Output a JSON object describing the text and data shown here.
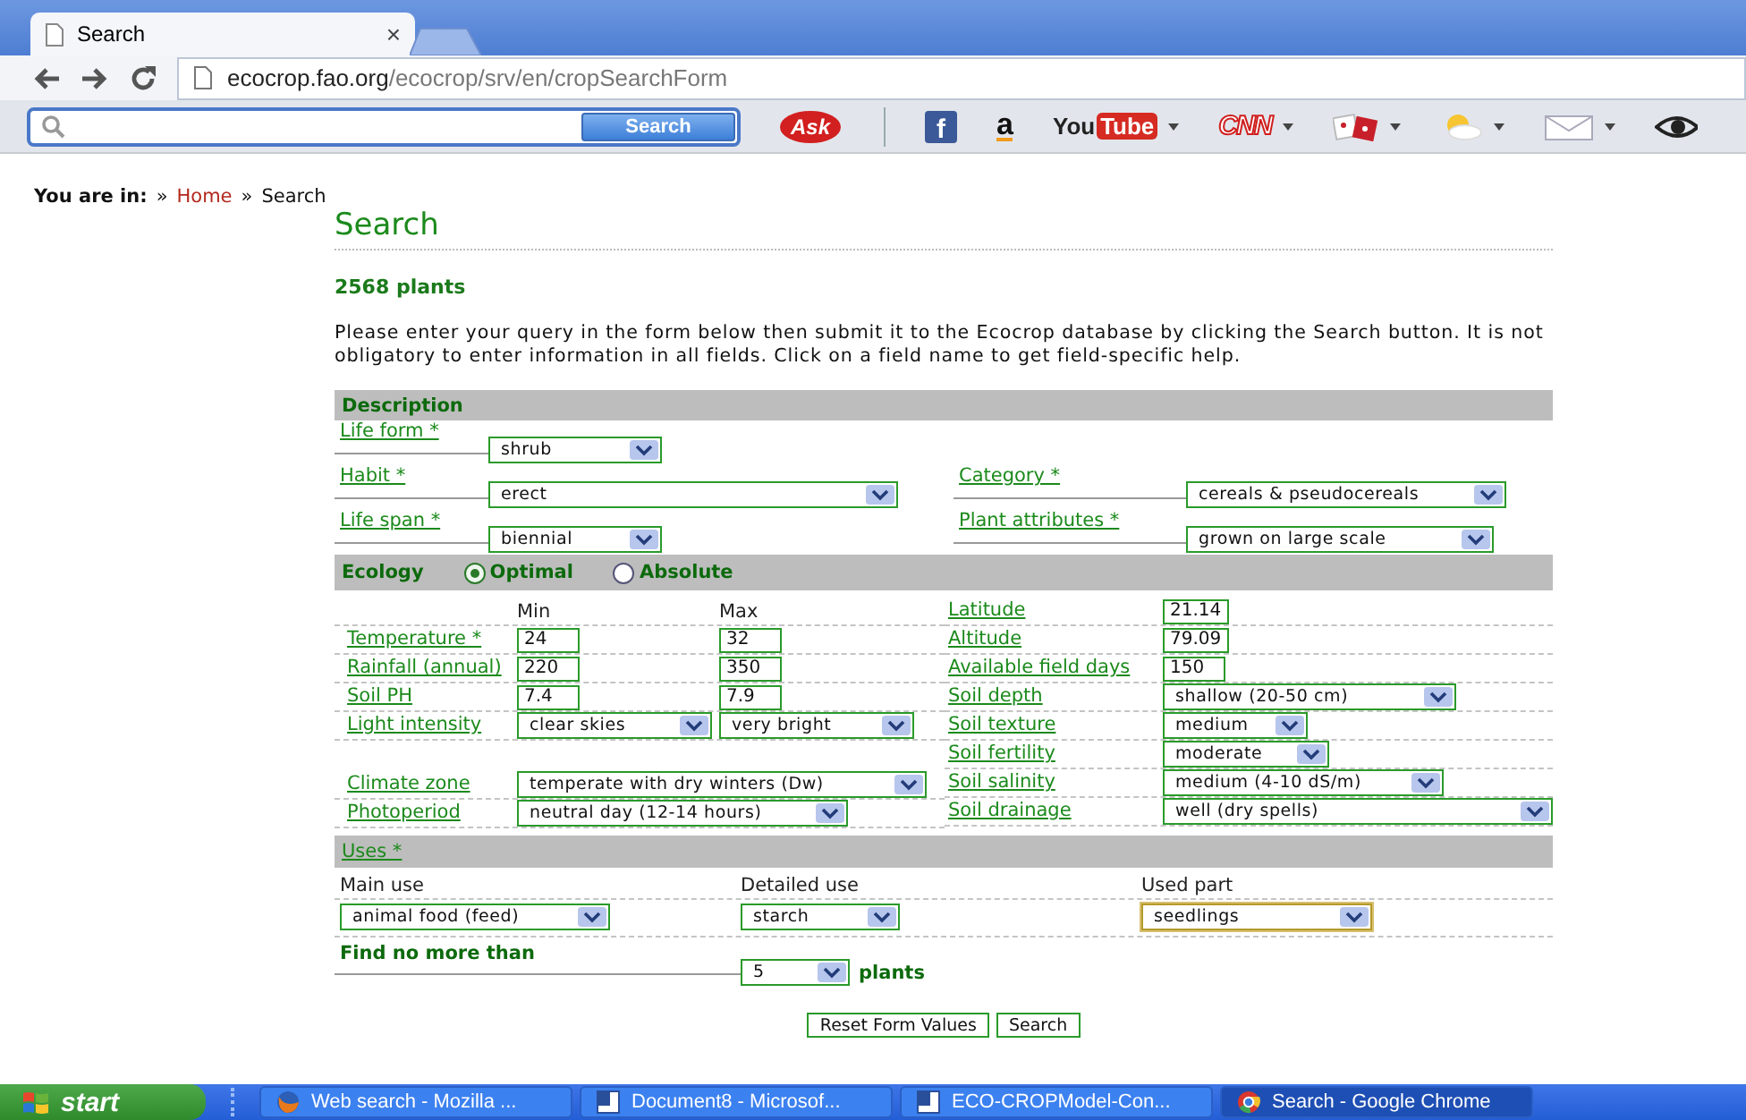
{
  "browser": {
    "tab": {
      "title": "Search",
      "close": "×",
      "selected": true
    },
    "address": {
      "host": "ecocrop.fao.org",
      "path": "/ecocrop/srv/en/cropSearchForm"
    },
    "toolbar": {
      "search_button": "Search",
      "items": [
        {
          "kind": "ask",
          "label": "Ask",
          "dropdown": false
        },
        {
          "kind": "facebook",
          "label": "f",
          "dropdown": false
        },
        {
          "kind": "amazon",
          "label": "a",
          "dropdown": false
        },
        {
          "kind": "youtube",
          "label": "You",
          "label_2": "Tube",
          "dropdown": true
        },
        {
          "kind": "cnn",
          "label": "CNN",
          "dropdown": true
        },
        {
          "kind": "games",
          "dropdown": true
        },
        {
          "kind": "weather",
          "dropdown": true
        },
        {
          "kind": "mail",
          "dropdown": true
        },
        {
          "kind": "eye",
          "dropdown": false
        }
      ]
    }
  },
  "page": {
    "breadcrumb": {
      "label": "You are in:",
      "items": [
        {
          "separator": "»",
          "text": "Home",
          "link": true
        },
        {
          "separator": "»",
          "text": "Search",
          "link": false
        }
      ]
    },
    "title": "Search",
    "count": "2568 plants",
    "intro": "Please enter your query in the form below then submit it to the Ecocrop database by clicking the Search button. It is not obligatory to enter information in all fields. Click on a field name to get field-specific help.",
    "description": {
      "header": "Description",
      "rows": [
        {
          "left": {
            "label": "Life form *",
            "value": "shrub"
          }
        },
        {
          "left": {
            "label": "Habit *",
            "value": "erect"
          },
          "right": {
            "label": "Category *",
            "value": "cereals & pseudocereals"
          }
        },
        {
          "left": {
            "label": "Life span *",
            "value": "biennial"
          },
          "right": {
            "label": "Plant attributes *",
            "value": "grown on large scale"
          }
        }
      ]
    },
    "ecology": {
      "header": "Ecology",
      "modes": [
        {
          "label": "Optimal",
          "selected": true
        },
        {
          "label": "Absolute",
          "selected": false
        }
      ],
      "min_header": "Min",
      "max_header": "Max",
      "left_rows": [
        {
          "kind": "range",
          "label": "Temperature *",
          "min": "24",
          "max": "32"
        },
        {
          "kind": "range",
          "label": "Rainfall (annual)",
          "min": "220",
          "max": "350"
        },
        {
          "kind": "range",
          "label": "Soil PH",
          "min": "7.4",
          "max": "7.9"
        },
        {
          "kind": "range_select",
          "label": "Light intensity",
          "min": "clear skies",
          "max": "very bright"
        },
        {
          "kind": "blank"
        },
        {
          "kind": "select",
          "label": "Climate zone",
          "value": "temperate with dry winters (Dw)"
        },
        {
          "kind": "select",
          "label": "Photoperiod",
          "value": "neutral day (12-14 hours)"
        }
      ],
      "right_rows": [
        {
          "kind": "input",
          "label": "Latitude",
          "value": "21.14"
        },
        {
          "kind": "input",
          "label": "Altitude",
          "value": "79.09"
        },
        {
          "kind": "input",
          "label": "Available field days",
          "value": "150"
        },
        {
          "kind": "select",
          "label": "Soil depth",
          "value": "shallow (20-50 cm)"
        },
        {
          "kind": "select",
          "label": "Soil texture",
          "value": "medium"
        },
        {
          "kind": "select",
          "label": "Soil fertility",
          "value": "moderate"
        },
        {
          "kind": "select",
          "label": "Soil salinity",
          "value": "medium (4-10 dS/m)"
        },
        {
          "kind": "select",
          "label": "Soil drainage",
          "value": "well (dry spells)"
        }
      ]
    },
    "uses": {
      "header": "Uses *",
      "columns": [
        {
          "label": "Main use",
          "value": "animal food (feed)",
          "focused": false
        },
        {
          "label": "Detailed use",
          "value": "starch",
          "focused": false
        },
        {
          "label": "Used part",
          "value": "seedlings",
          "focused": true
        }
      ]
    },
    "limit": {
      "label": "Find no more than",
      "value": "5",
      "unit": "plants"
    },
    "buttons": [
      "Reset Form Values",
      "Search"
    ]
  },
  "taskbar": {
    "start": "start",
    "items": [
      {
        "kind": "firefox",
        "label": "Web search - Mozilla ...",
        "selected": false
      },
      {
        "kind": "word",
        "label": "Document8 - Microsof...",
        "selected": false
      },
      {
        "kind": "word",
        "label": "ECO-CROPModel-Con...",
        "selected": false
      },
      {
        "kind": "chrome",
        "label": "Search - Google Chrome",
        "selected": true
      }
    ]
  }
}
